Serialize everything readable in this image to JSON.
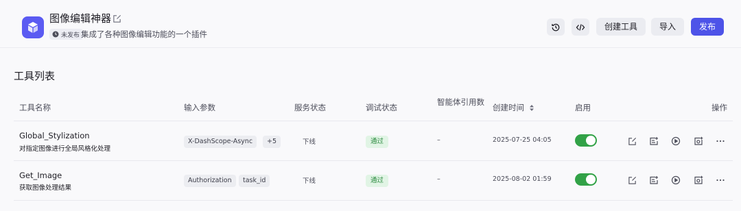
{
  "header": {
    "plugin_name": "图像编辑神器",
    "status": "未发布",
    "description": "集成了各种图像编辑功能的一个插件",
    "create_tool_label": "创建工具",
    "import_label": "导入",
    "publish_label": "发布"
  },
  "section": {
    "title": "工具列表"
  },
  "table": {
    "columns": {
      "name": "工具名称",
      "params": "输入参数",
      "service_status": "服务状态",
      "debug_status": "调试状态",
      "agent_refs": "智能体引用数",
      "created": "创建时间",
      "enabled": "启用",
      "actions": "操作"
    },
    "rows": [
      {
        "name": "Global_Stylization",
        "desc": "对指定图像进行全局风格化处理",
        "params": [
          "X-DashScope-Async",
          "+5"
        ],
        "service_status": "下线",
        "debug_status": "通过",
        "agent_refs": "–",
        "created": "2025-07-25 04:05",
        "enabled": true
      },
      {
        "name": "Get_Image",
        "desc": "获取图像处理结果",
        "params": [
          "Authorization",
          "task_id"
        ],
        "service_status": "下线",
        "debug_status": "通过",
        "agent_refs": "–",
        "created": "2025-08-02 01:59",
        "enabled": true
      }
    ]
  },
  "colors": {
    "primary": "#4d53e8",
    "plugin_icon_bg": "#5b5bf2",
    "toggle_on": "#32a247",
    "pass_bg": "#e1f4e5",
    "pass_text": "#2a8a3e"
  },
  "icons": {
    "header": [
      "history-icon",
      "code-icon"
    ],
    "row_actions": [
      "edit-icon",
      "add-list-icon",
      "play-icon",
      "screenshot-add-icon",
      "more-icon"
    ]
  }
}
